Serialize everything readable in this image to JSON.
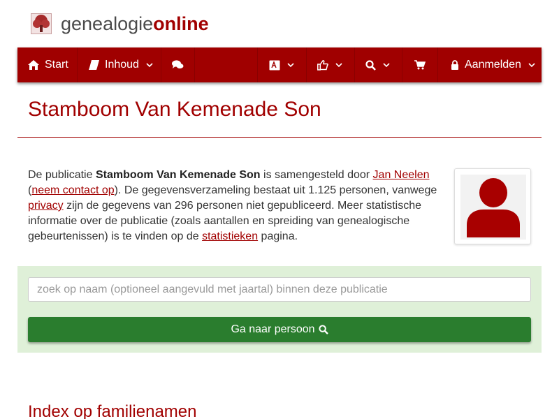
{
  "brand": {
    "part1": "genealogie",
    "part2": "online",
    "logo_icon": "tree-icon"
  },
  "colors": {
    "brand_red": "#a00000",
    "panel_green": "#dff0d8",
    "button_green": "#2a7d2e"
  },
  "nav": {
    "start_label": "Start",
    "content_label": "Inhoud",
    "login_label": "Aanmelden",
    "icons": [
      "home-icon",
      "book-icon",
      "comments-icon",
      "language-icon",
      "thumbs-up-icon",
      "search-icon",
      "shopping-cart-icon",
      "lock-icon",
      "chevron-down-icon"
    ]
  },
  "page": {
    "title": "Stamboom Van Kemenade Son"
  },
  "intro": {
    "t1": "De publicatie ",
    "pub_name": "Stamboom Van Kemenade Son",
    "t2": " is samengesteld door ",
    "author": "Jan Neelen",
    "t3": " (",
    "contact": "neem contact op",
    "t4": "). De gegevensverzameling bestaat uit 1.125 personen, vanwege ",
    "privacy": "privacy",
    "t5": " zijn de gegevens van 296 personen niet gepubliceerd. Meer statistische informatie over de publicatie (zoals aantallen en spreiding van genealogische gebeurtenissen) is te vinden op de ",
    "stats": "statistieken",
    "t6": " pagina."
  },
  "search": {
    "placeholder": "zoek op naam (optioneel aangevuld met jaartal) binnen deze publicatie",
    "button_label": "Ga naar persoon"
  },
  "sections": {
    "surnames_heading": "Index op familienamen"
  }
}
